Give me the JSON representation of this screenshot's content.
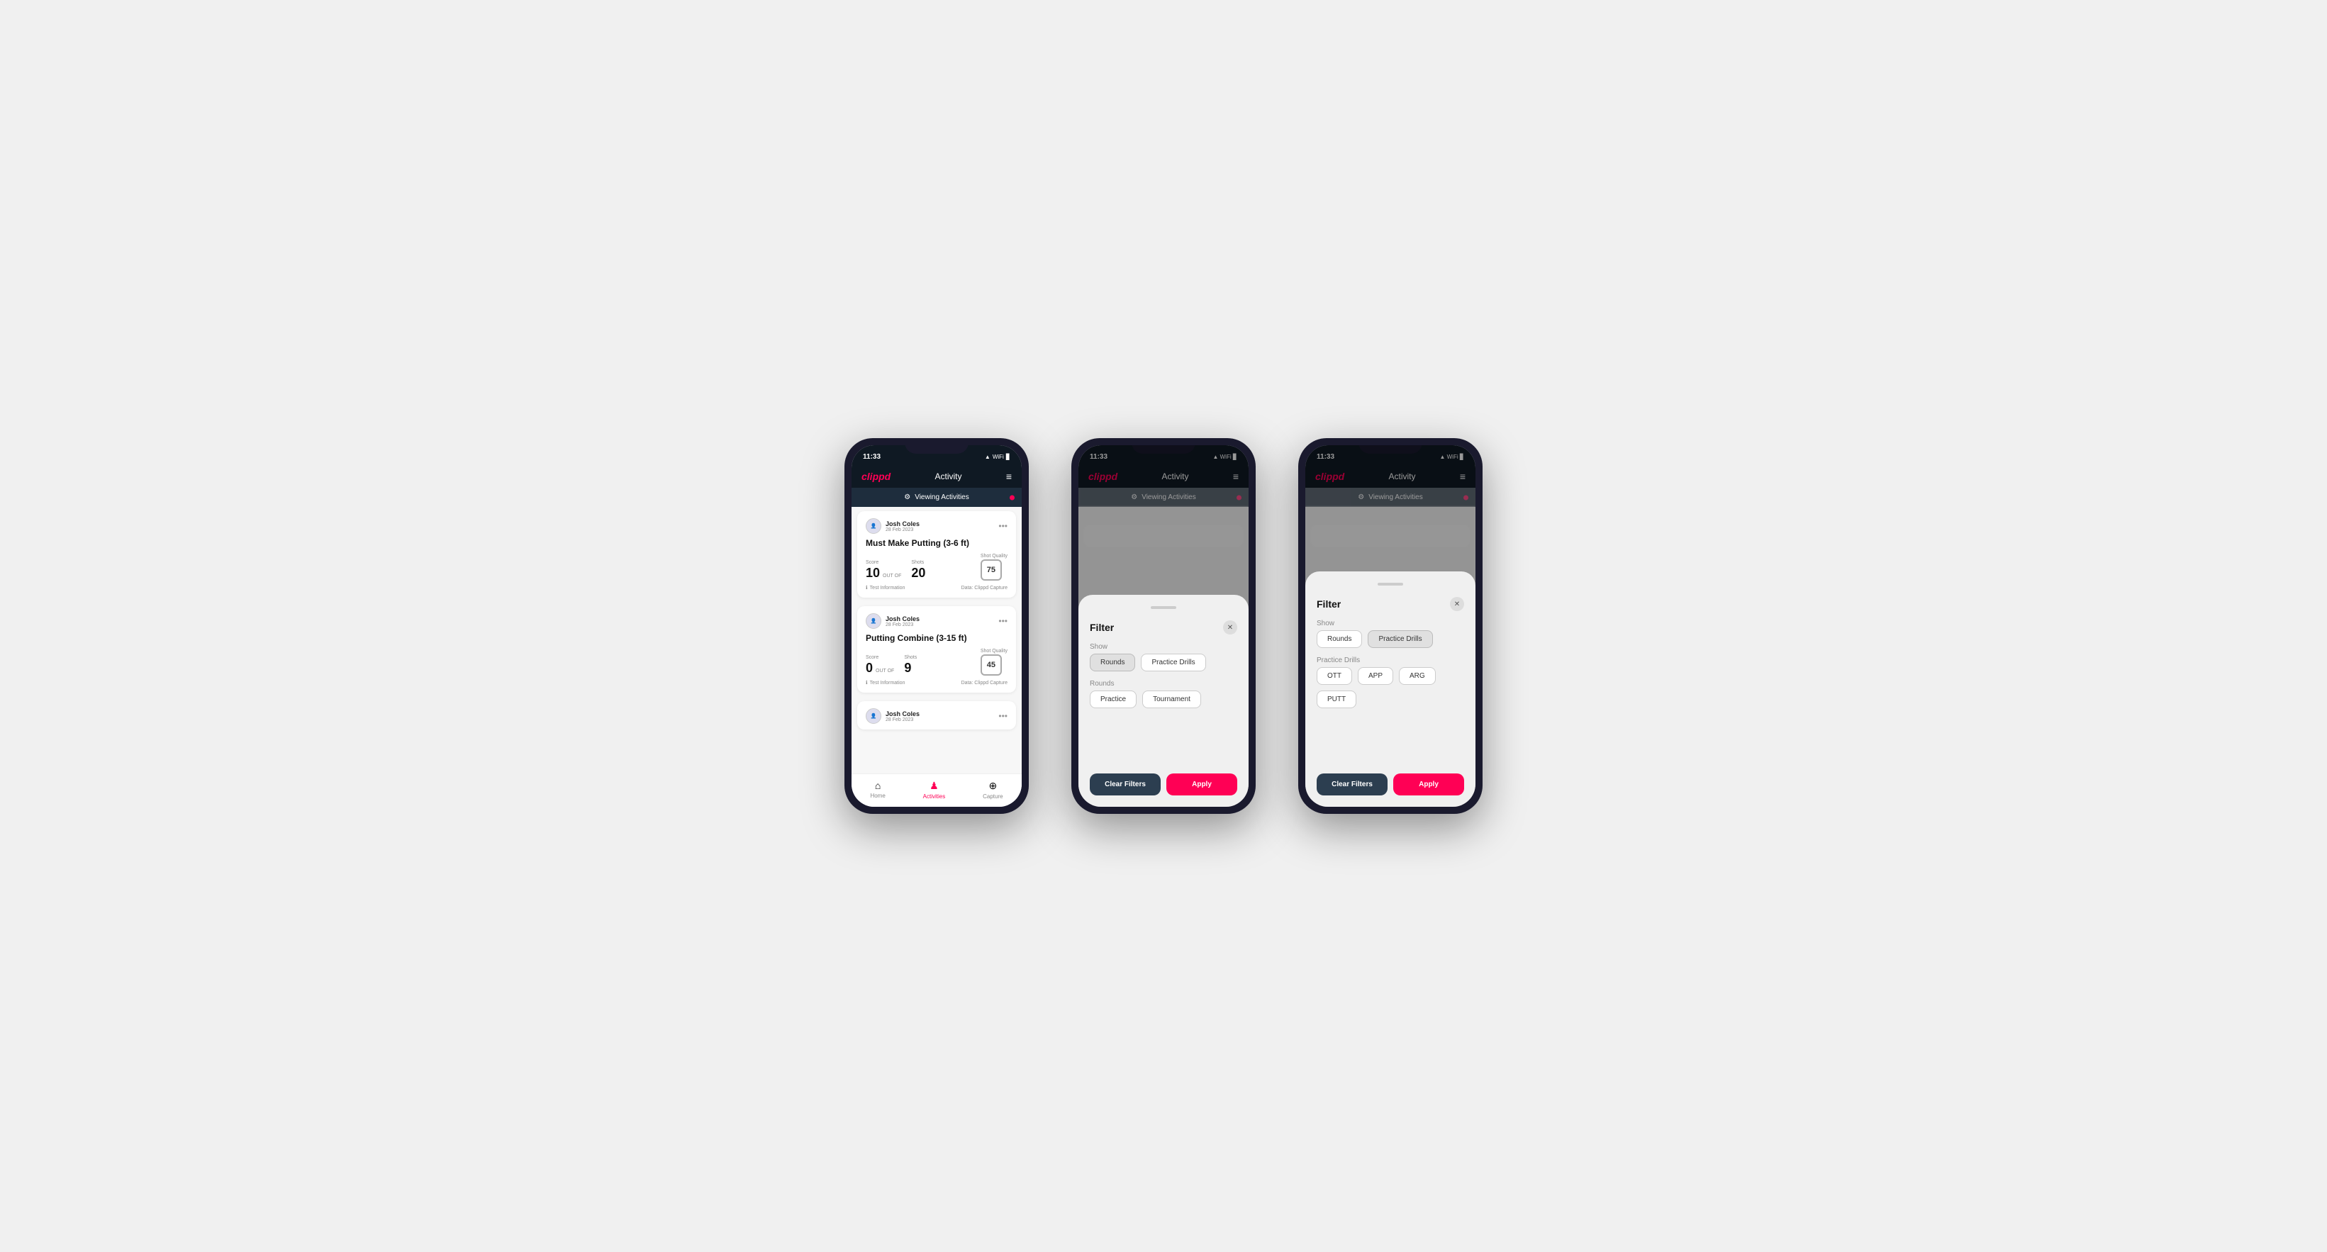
{
  "phones": [
    {
      "id": "phone1",
      "statusBar": {
        "time": "11:33",
        "icons": "▲ ↑ ▊"
      },
      "header": {
        "logo": "clippd",
        "title": "Activity",
        "menuIcon": "≡"
      },
      "viewingBanner": {
        "icon": "⚙",
        "label": "Viewing Activities"
      },
      "cards": [
        {
          "userName": "Josh Coles",
          "userDate": "28 Feb 2023",
          "title": "Must Make Putting (3-6 ft)",
          "scoreLabel": "Score",
          "scoreValue": "10",
          "outOfLabel": "OUT OF",
          "shotsLabel": "Shots",
          "shotsValue": "20",
          "shotQualityLabel": "Shot Quality",
          "shotQualityValue": "75",
          "footerInfo": "Test Information",
          "footerData": "Data: Clippd Capture"
        },
        {
          "userName": "Josh Coles",
          "userDate": "28 Feb 2023",
          "title": "Putting Combine (3-15 ft)",
          "scoreLabel": "Score",
          "scoreValue": "0",
          "outOfLabel": "OUT OF",
          "shotsLabel": "Shots",
          "shotsValue": "9",
          "shotQualityLabel": "Shot Quality",
          "shotQualityValue": "45",
          "footerInfo": "Test Information",
          "footerData": "Data: Clippd Capture"
        },
        {
          "userName": "Josh Coles",
          "userDate": "28 Feb 2023",
          "title": "",
          "scoreLabel": "",
          "scoreValue": "",
          "outOfLabel": "",
          "shotsLabel": "",
          "shotsValue": "",
          "shotQualityLabel": "",
          "shotQualityValue": "",
          "footerInfo": "",
          "footerData": ""
        }
      ],
      "bottomNav": [
        {
          "icon": "⌂",
          "label": "Home",
          "active": false
        },
        {
          "icon": "♟",
          "label": "Activities",
          "active": true
        },
        {
          "icon": "⊕",
          "label": "Capture",
          "active": false
        }
      ]
    },
    {
      "id": "phone2",
      "statusBar": {
        "time": "11:33",
        "icons": "▲ ↑ ▊"
      },
      "header": {
        "logo": "clippd",
        "title": "Activity",
        "menuIcon": "≡"
      },
      "viewingBanner": {
        "icon": "⚙",
        "label": "Viewing Activities"
      },
      "filter": {
        "title": "Filter",
        "showLabel": "Show",
        "showButtons": [
          {
            "label": "Rounds",
            "active": true
          },
          {
            "label": "Practice Drills",
            "active": false
          }
        ],
        "roundsLabel": "Rounds",
        "roundsButtons": [
          {
            "label": "Practice",
            "active": false
          },
          {
            "label": "Tournament",
            "active": false
          }
        ],
        "clearLabel": "Clear Filters",
        "applyLabel": "Apply"
      }
    },
    {
      "id": "phone3",
      "statusBar": {
        "time": "11:33",
        "icons": "▲ ↑ ▊"
      },
      "header": {
        "logo": "clippd",
        "title": "Activity",
        "menuIcon": "≡"
      },
      "viewingBanner": {
        "icon": "⚙",
        "label": "Viewing Activities"
      },
      "filter": {
        "title": "Filter",
        "showLabel": "Show",
        "showButtons": [
          {
            "label": "Rounds",
            "active": false
          },
          {
            "label": "Practice Drills",
            "active": true
          }
        ],
        "drillsLabel": "Practice Drills",
        "drillsButtons": [
          {
            "label": "OTT",
            "active": false
          },
          {
            "label": "APP",
            "active": false
          },
          {
            "label": "ARG",
            "active": false
          },
          {
            "label": "PUTT",
            "active": false
          }
        ],
        "clearLabel": "Clear Filters",
        "applyLabel": "Apply"
      }
    }
  ]
}
